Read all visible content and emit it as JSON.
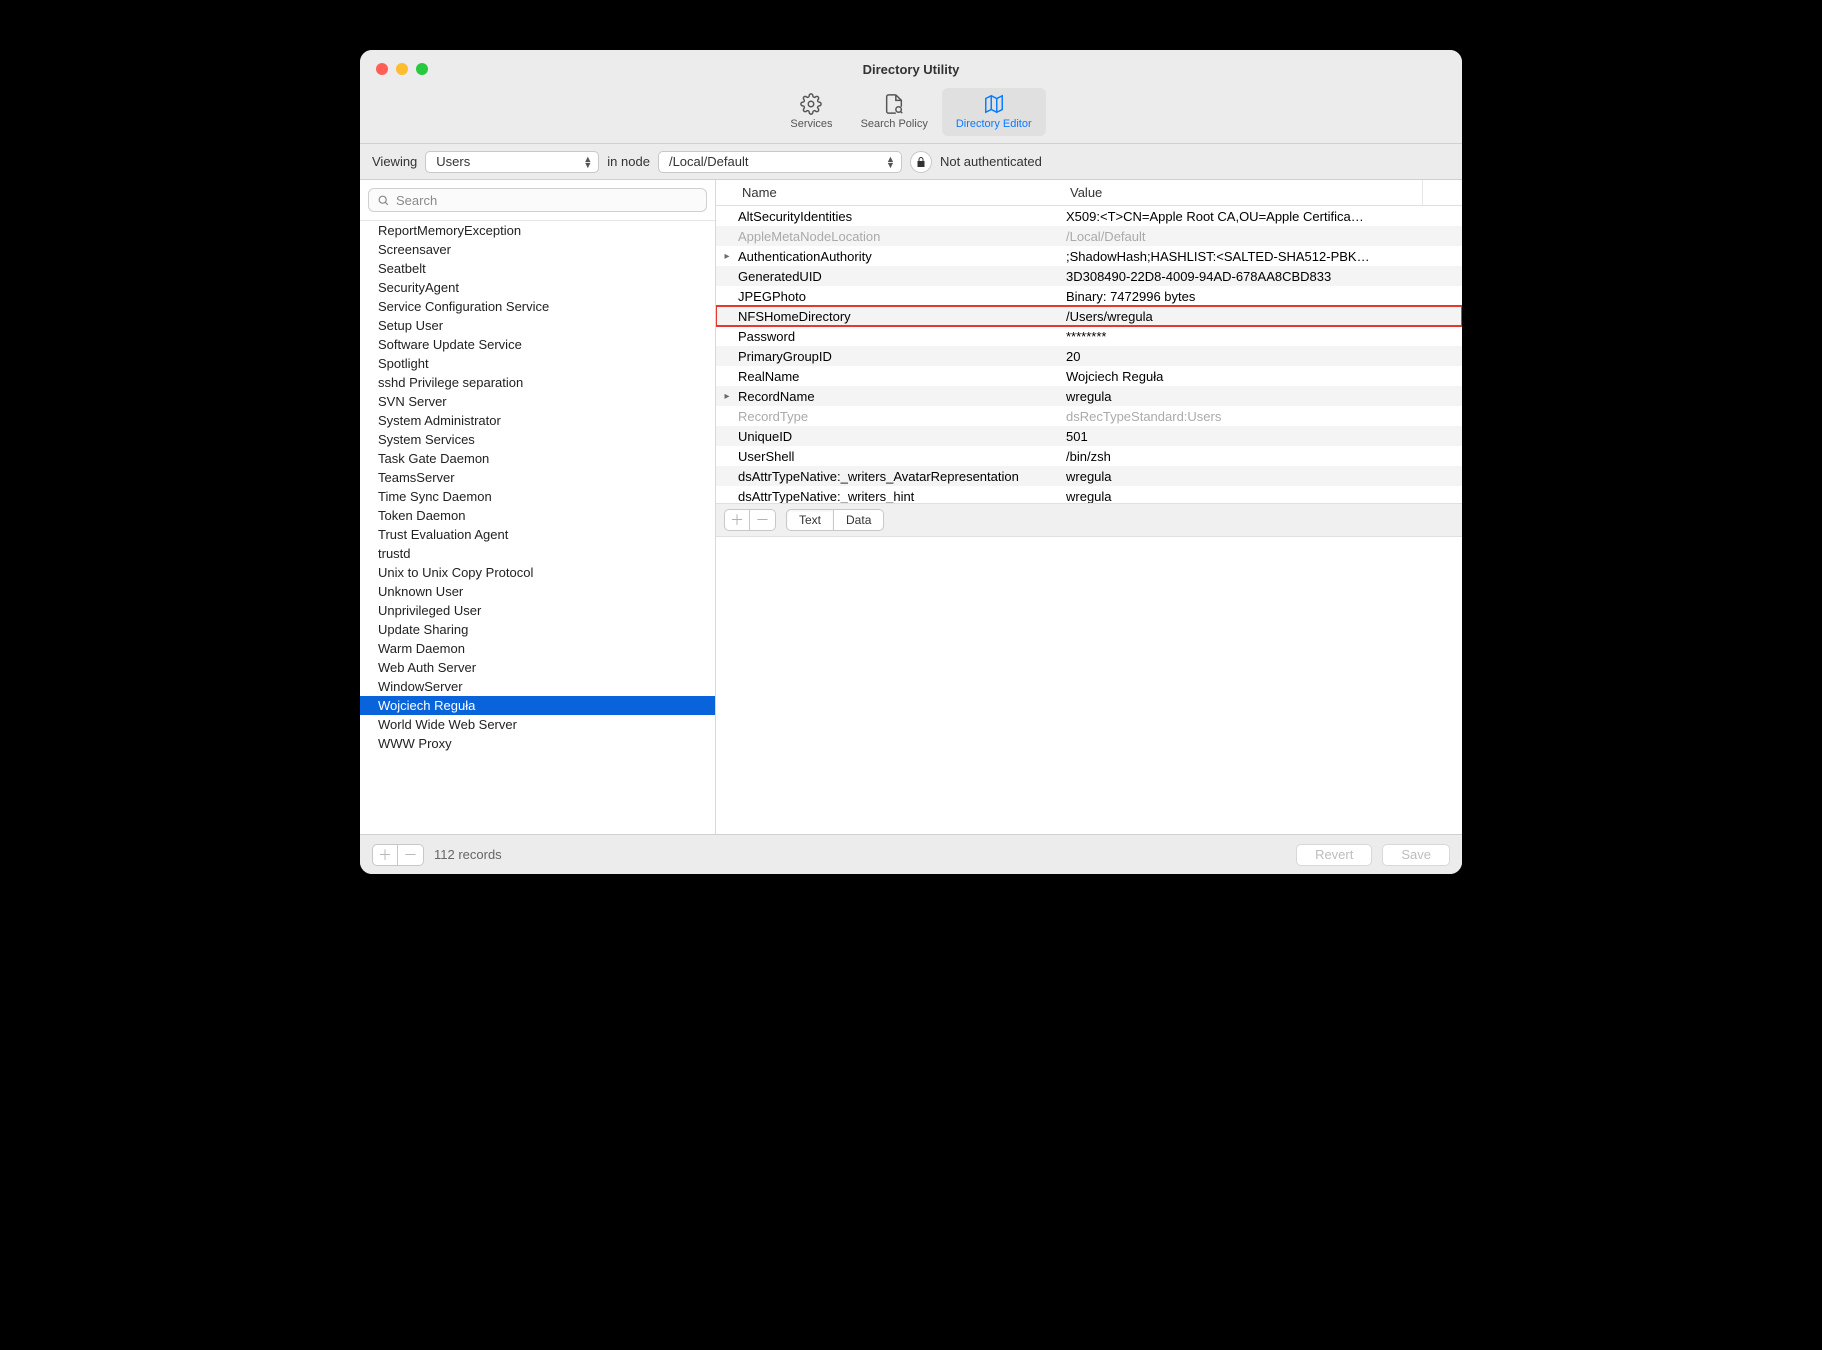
{
  "window": {
    "title": "Directory Utility"
  },
  "toolbar": {
    "items": [
      {
        "label": "Services"
      },
      {
        "label": "Search Policy"
      },
      {
        "label": "Directory Editor"
      }
    ],
    "selected_index": 2
  },
  "filter": {
    "viewing_label": "Viewing",
    "viewing_value": "Users",
    "in_node_label": "in node",
    "node_value": "/Local/Default",
    "auth_status": "Not authenticated"
  },
  "search": {
    "placeholder": "Search"
  },
  "user_list": {
    "items": [
      "ReportMemoryException",
      "Screensaver",
      "Seatbelt",
      "SecurityAgent",
      "Service Configuration Service",
      "Setup User",
      "Software Update Service",
      "Spotlight",
      "sshd Privilege separation",
      "SVN Server",
      "System Administrator",
      "System Services",
      "Task Gate Daemon",
      "TeamsServer",
      "Time Sync Daemon",
      "Token Daemon",
      "Trust Evaluation Agent",
      "trustd",
      "Unix to Unix Copy Protocol",
      "Unknown User",
      "Unprivileged User",
      "Update Sharing",
      "Warm Daemon",
      "Web Auth Server",
      "WindowServer",
      "Wojciech Reguła",
      "World Wide Web Server",
      "WWW Proxy"
    ],
    "selected_index": 25
  },
  "detail": {
    "columns": {
      "name": "Name",
      "value": "Value"
    },
    "attributes": [
      {
        "name": "AltSecurityIdentities",
        "value": "X509:<T>CN=Apple Root CA,OU=Apple Certifica…",
        "dim": false,
        "disclosure": false
      },
      {
        "name": "AppleMetaNodeLocation",
        "value": "/Local/Default",
        "dim": true,
        "disclosure": false
      },
      {
        "name": "AuthenticationAuthority",
        "value": ";ShadowHash;HASHLIST:<SALTED-SHA512-PBK…",
        "dim": false,
        "disclosure": true
      },
      {
        "name": "GeneratedUID",
        "value": "3D308490-22D8-4009-94AD-678AA8CBD833",
        "dim": false,
        "disclosure": false
      },
      {
        "name": "JPEGPhoto",
        "value": "Binary: 7472996 bytes",
        "dim": false,
        "disclosure": false
      },
      {
        "name": "NFSHomeDirectory",
        "value": "/Users/wregula",
        "dim": false,
        "disclosure": false,
        "highlight": true
      },
      {
        "name": "Password",
        "value": "********",
        "dim": false,
        "disclosure": false
      },
      {
        "name": "PrimaryGroupID",
        "value": "20",
        "dim": false,
        "disclosure": false
      },
      {
        "name": "RealName",
        "value": "Wojciech Reguła",
        "dim": false,
        "disclosure": false
      },
      {
        "name": "RecordName",
        "value": "wregula",
        "dim": false,
        "disclosure": true
      },
      {
        "name": "RecordType",
        "value": "dsRecTypeStandard:Users",
        "dim": true,
        "disclosure": false
      },
      {
        "name": "UniqueID",
        "value": "501",
        "dim": false,
        "disclosure": false
      },
      {
        "name": "UserShell",
        "value": "/bin/zsh",
        "dim": false,
        "disclosure": false
      },
      {
        "name": "dsAttrTypeNative:_writers_AvatarRepresentation",
        "value": "wregula",
        "dim": false,
        "disclosure": false
      },
      {
        "name": "dsAttrTypeNative:_writers_hint",
        "value": "wregula",
        "dim": false,
        "disclosure": false
      }
    ],
    "seg": {
      "text": "Text",
      "data": "Data"
    }
  },
  "footer": {
    "record_count": "112 records",
    "revert": "Revert",
    "save": "Save"
  }
}
